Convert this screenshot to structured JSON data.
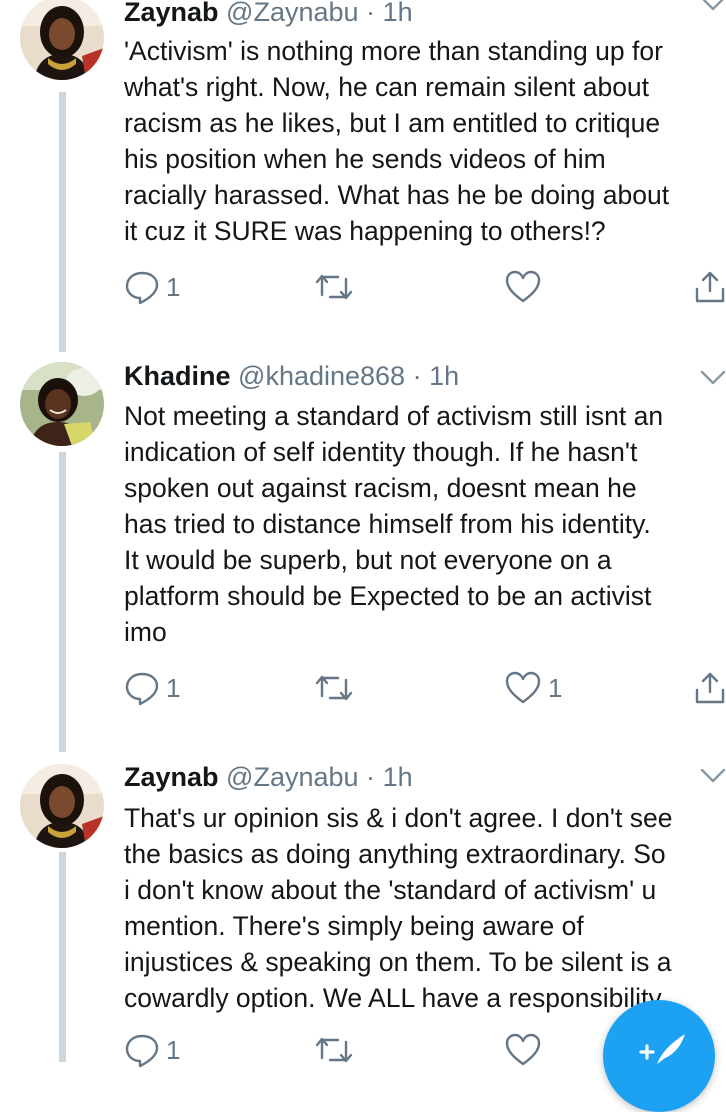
{
  "colors": {
    "text": "#14171a",
    "secondary": "#657786",
    "thread_line": "#ccd6dd",
    "accent": "#1da1f2"
  },
  "tweets": [
    {
      "name": "Zaynab",
      "handle": "@Zaynabu",
      "separator": "·",
      "time": "1h",
      "text": "'Activism' is nothing more than standing up for\nwhat's right. Now, he can remain silent about\nracism as he likes, but I am entitled to critique\nhis position when he sends videos of him\nracially harassed. What has he be doing about\nit cuz it SURE was happening to others!?",
      "reply_count": "1",
      "retweet_count": "",
      "like_count": ""
    },
    {
      "name": "Khadine",
      "handle": "@khadine868",
      "separator": "·",
      "time": "1h",
      "text": "Not meeting a standard of activism still isnt an\nindication of self identity though. If he hasn't\nspoken out against racism, doesnt mean he\nhas tried to distance himself from his identity.\nIt would be superb, but not everyone on a\nplatform should be Expected to be an activist\nimo",
      "reply_count": "1",
      "retweet_count": "",
      "like_count": "1"
    },
    {
      "name": "Zaynab",
      "handle": "@Zaynabu",
      "separator": "·",
      "time": "1h",
      "text": "That's ur opinion sis & i don't agree. I don't see\nthe basics as doing anything extraordinary. So\ni don't know about the 'standard of activism' u\nmention. There's simply being aware of\ninjustices & speaking on them. To be silent is a\ncowardly option. We ALL have a responsibility.",
      "reply_count": "1",
      "retweet_count": "",
      "like_count": ""
    }
  ],
  "icons": {
    "reply": "reply-icon",
    "retweet": "retweet-icon",
    "like": "heart-icon",
    "share": "share-icon",
    "chevron": "chevron-down-icon",
    "compose": "compose-tweet-icon"
  }
}
